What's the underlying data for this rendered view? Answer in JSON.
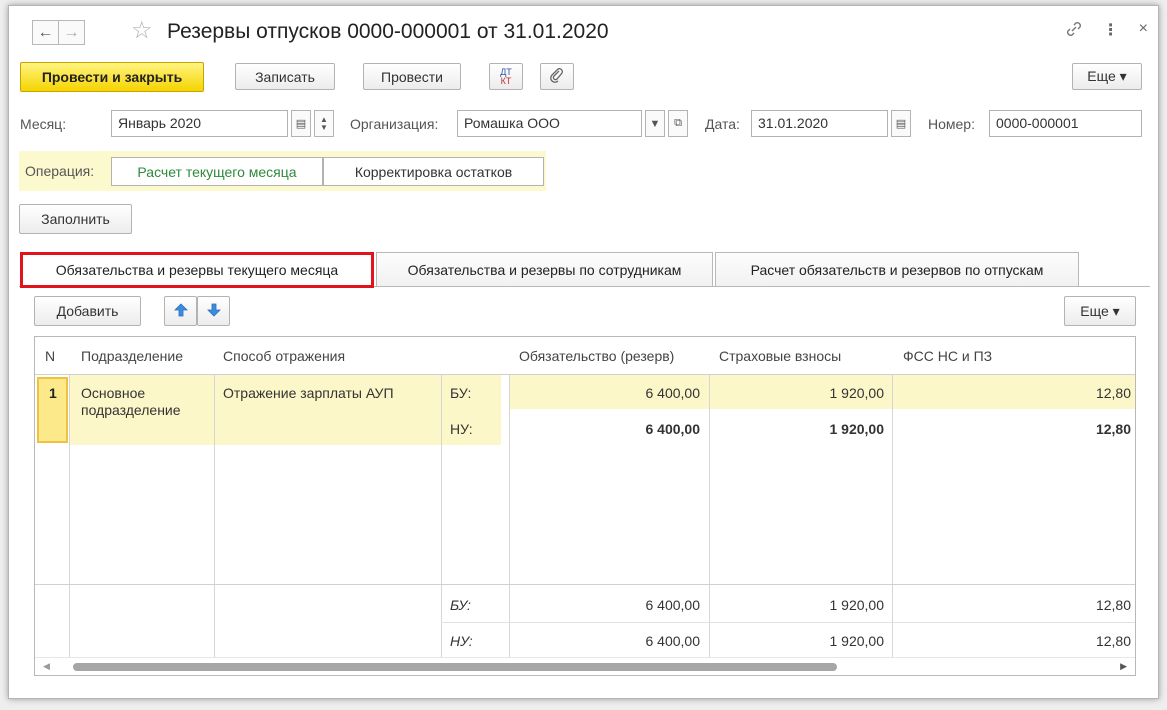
{
  "window": {
    "title": "Резервы отпусков 0000-000001 от 31.01.2020"
  },
  "toolbar": {
    "post_close": "Провести и закрыть",
    "save": "Записать",
    "post": "Провести",
    "dtkt_top": "ДТ",
    "dtkt_bottom": "КТ",
    "more": "Еще ▾"
  },
  "form": {
    "month_label": "Месяц:",
    "month_value": "Январь 2020",
    "org_label": "Организация:",
    "org_value": "Ромашка ООО",
    "date_label": "Дата:",
    "date_value": "31.01.2020",
    "number_label": "Номер:",
    "number_value": "0000-000001"
  },
  "operation": {
    "label": "Операция:",
    "options": [
      "Расчет текущего месяца",
      "Корректировка остатков"
    ],
    "selected_color": "#2f8a3a"
  },
  "fill_button": "Заполнить",
  "tabs": [
    "Обязательства и резервы текущего месяца",
    "Обязательства и резервы по сотрудникам",
    "Расчет обязательств и резервов по отпускам"
  ],
  "table_toolbar": {
    "add": "Добавить",
    "more": "Еще ▾"
  },
  "table": {
    "columns": [
      "N",
      "Подразделение",
      "Способ отражения",
      "",
      "Обязательство (резерв)",
      "Страховые взносы",
      "ФСС НС и ПЗ"
    ],
    "rows": [
      {
        "n": "1",
        "department": "Основное подразделение",
        "method": "Отражение зарплаты АУП",
        "lines": [
          {
            "type": "БУ:",
            "obligation": "6 400,00",
            "insurance": "1 920,00",
            "fss": "12,80"
          },
          {
            "type": "НУ:",
            "obligation": "6 400,00",
            "insurance": "1 920,00",
            "fss": "12,80"
          }
        ]
      }
    ],
    "totals": [
      {
        "type": "БУ:",
        "obligation": "6 400,00",
        "insurance": "1 920,00",
        "fss": "12,80"
      },
      {
        "type": "НУ:",
        "obligation": "6 400,00",
        "insurance": "1 920,00",
        "fss": "12,80"
      }
    ]
  }
}
